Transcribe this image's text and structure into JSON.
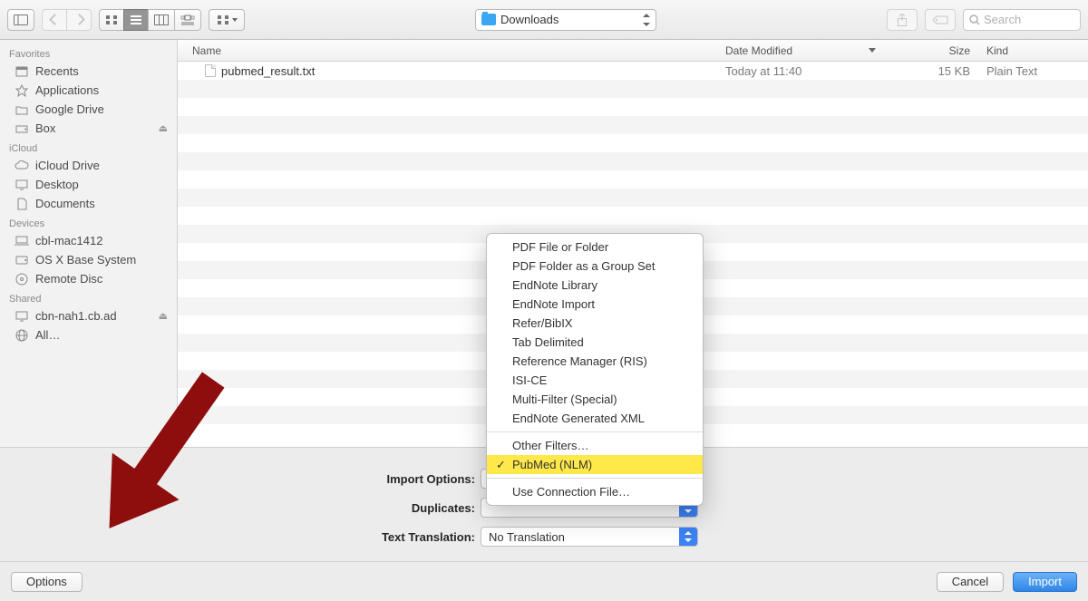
{
  "toolbar": {
    "location_label": "Downloads",
    "search_placeholder": "Search"
  },
  "sidebar": {
    "groups": [
      {
        "label": "Favorites",
        "items": [
          {
            "label": "Recents",
            "icon": "recents-icon"
          },
          {
            "label": "Applications",
            "icon": "applications-icon"
          },
          {
            "label": "Google Drive",
            "icon": "folder-icon"
          },
          {
            "label": "Box",
            "icon": "drive-icon",
            "eject": true
          }
        ]
      },
      {
        "label": "iCloud",
        "items": [
          {
            "label": "iCloud Drive",
            "icon": "icloud-icon"
          },
          {
            "label": "Desktop",
            "icon": "desktop-icon"
          },
          {
            "label": "Documents",
            "icon": "documents-icon"
          }
        ]
      },
      {
        "label": "Devices",
        "items": [
          {
            "label": "cbl-mac1412",
            "icon": "computer-icon"
          },
          {
            "label": "OS X Base System",
            "icon": "disk-icon"
          },
          {
            "label": "Remote Disc",
            "icon": "optical-icon"
          }
        ]
      },
      {
        "label": "Shared",
        "items": [
          {
            "label": "cbn-nah1.cb.ad",
            "icon": "server-icon",
            "eject": true
          },
          {
            "label": "All…",
            "icon": "globe-icon"
          }
        ]
      }
    ]
  },
  "columns": {
    "name": "Name",
    "date": "Date Modified",
    "size": "Size",
    "kind": "Kind"
  },
  "files": [
    {
      "name": "pubmed_result.txt",
      "date": "Today at 11:40",
      "size": "15 KB",
      "kind": "Plain Text"
    }
  ],
  "options": {
    "import_options_label": "Import Options:",
    "duplicates_label": "Duplicates:",
    "text_translation_label": "Text Translation:",
    "text_translation_value": "No Translation"
  },
  "popup": {
    "items_top": [
      "PDF File or Folder",
      "PDF Folder as a Group Set",
      "EndNote Library",
      "EndNote Import",
      "Refer/BibIX",
      "Tab Delimited",
      "Reference Manager (RIS)",
      "ISI-CE",
      "Multi-Filter (Special)",
      "EndNote Generated XML"
    ],
    "other_filters": "Other Filters…",
    "selected": "PubMed (NLM)",
    "use_connection": "Use Connection File…"
  },
  "footer": {
    "options": "Options",
    "cancel": "Cancel",
    "import": "Import"
  }
}
